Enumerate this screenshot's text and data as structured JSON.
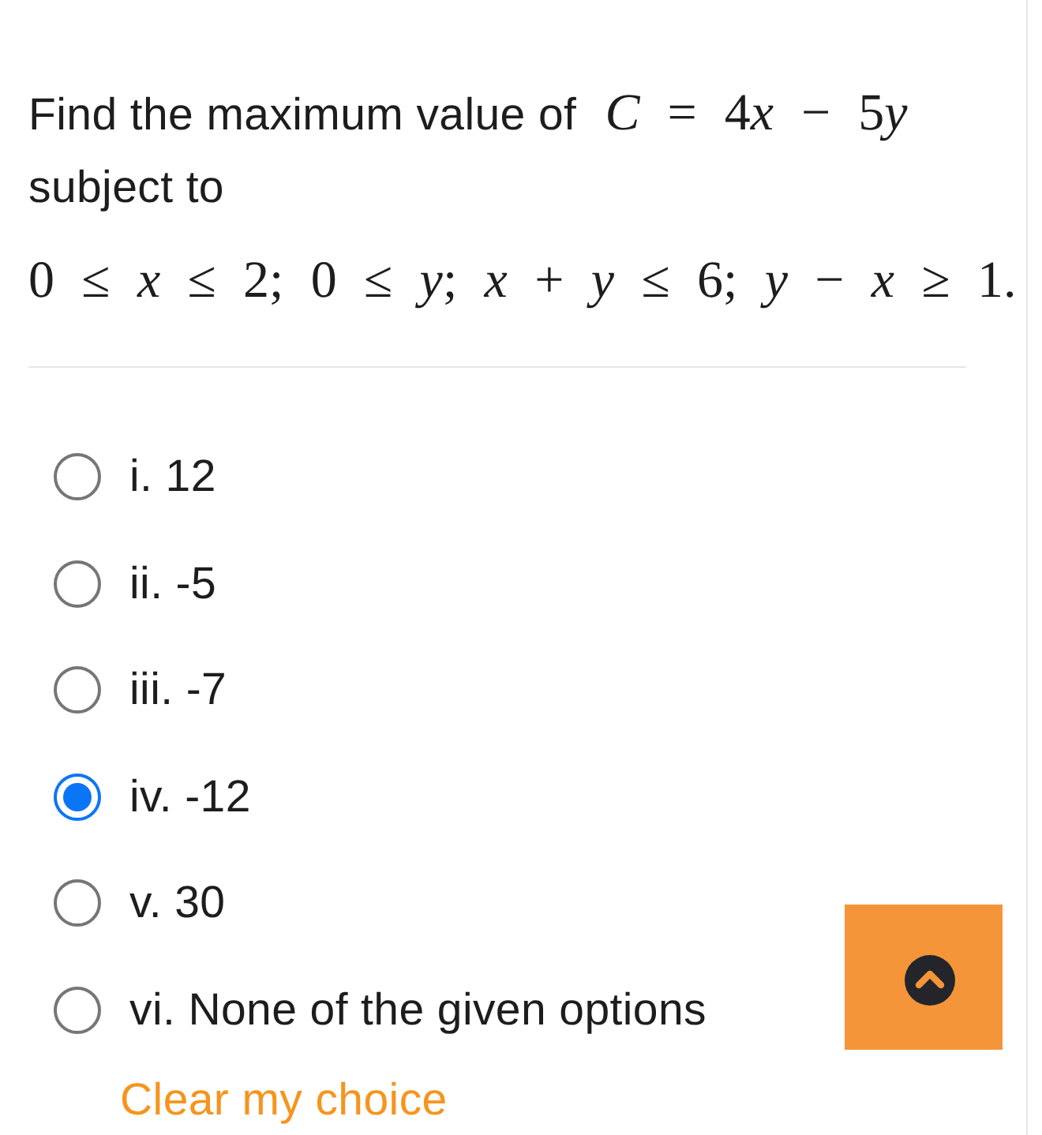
{
  "question": {
    "prompt": "Find the maximum value of",
    "objective": "C = 4x − 5y",
    "prompt_end": "subject to",
    "constraints": "0 ≤ x ≤ 2; 0 ≤ y; x + y ≤ 6; y − x ≥ 1."
  },
  "options": [
    {
      "label": "i. 12",
      "selected": false
    },
    {
      "label": "ii. -5",
      "selected": false
    },
    {
      "label": "iii. -7",
      "selected": false
    },
    {
      "label": "iv. -12",
      "selected": true
    },
    {
      "label": "v. 30",
      "selected": false
    },
    {
      "label": "vi. None of the given options",
      "selected": false
    }
  ],
  "clear_link": "Clear my choice"
}
